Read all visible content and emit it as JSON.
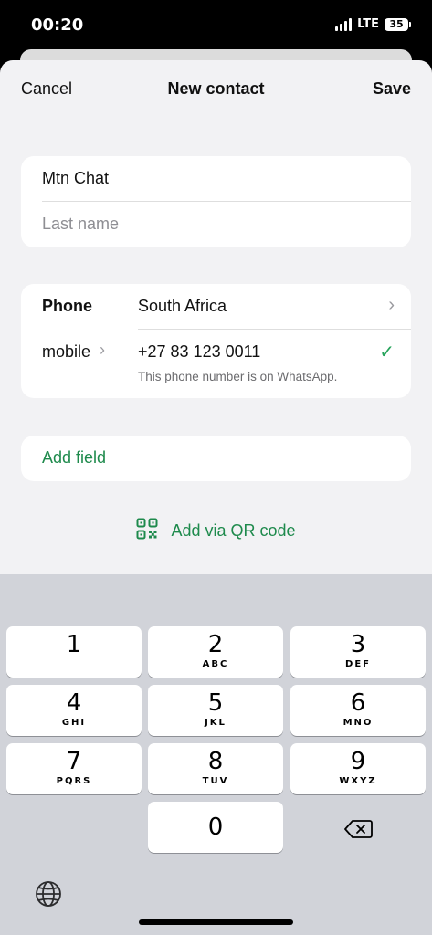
{
  "status": {
    "time": "00:20",
    "network": "LTE",
    "battery": "35"
  },
  "nav": {
    "cancel": "Cancel",
    "title": "New contact",
    "save": "Save"
  },
  "name_fields": {
    "first_name_value": "Mtn Chat",
    "last_name_placeholder": "Last name"
  },
  "phone": {
    "label": "Phone",
    "country": "South Africa",
    "type": "mobile",
    "number": "+27  83 123 0011",
    "note": "This phone number is on WhatsApp."
  },
  "add_field": "Add field",
  "qr": {
    "label": "Add via QR code"
  },
  "keypad": [
    {
      "digit": "1",
      "letters": ""
    },
    {
      "digit": "2",
      "letters": "ABC"
    },
    {
      "digit": "3",
      "letters": "DEF"
    },
    {
      "digit": "4",
      "letters": "GHI"
    },
    {
      "digit": "5",
      "letters": "JKL"
    },
    {
      "digit": "6",
      "letters": "MNO"
    },
    {
      "digit": "7",
      "letters": "PQRS"
    },
    {
      "digit": "8",
      "letters": "TUV"
    },
    {
      "digit": "9",
      "letters": "WXYZ"
    },
    {
      "digit": "0",
      "letters": ""
    }
  ],
  "colors": {
    "accent_green": "#1e8a4c",
    "check_green": "#25a35a",
    "sheet_bg": "#f2f2f4",
    "keyboard_bg": "#d1d3d9"
  },
  "icons": {
    "chevron": "chevron-right-icon",
    "check": "checkmark-icon",
    "qr": "qr-code-icon",
    "delete": "delete-backspace-icon",
    "globe": "globe-icon"
  }
}
